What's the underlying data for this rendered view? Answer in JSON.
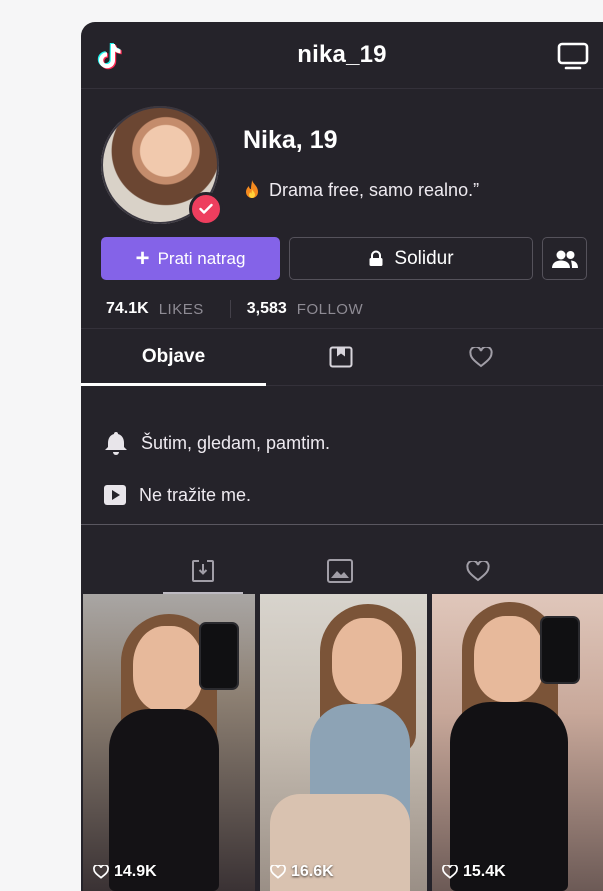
{
  "header": {
    "title": "nika_19",
    "left_icon": "tiktok-logo-icon",
    "right_icon": "tv-icon"
  },
  "profile": {
    "name": "Nika, 19",
    "bio": "Drama free, samo realno.”",
    "bio_icon": "fire-icon",
    "verified_icon": "checkmark-icon"
  },
  "actions": {
    "follow_label": "Prati natrag",
    "message_label": "Solidur",
    "friends_icon": "friends-icon"
  },
  "stats": [
    {
      "value": "74.1K",
      "label": "LIKES"
    },
    {
      "value": "3,583",
      "label": "FOLLOW"
    }
  ],
  "tabs": {
    "primary": [
      {
        "label": "Objave",
        "active": true
      },
      {
        "icon": "bookmark-icon"
      },
      {
        "icon": "heart-icon"
      }
    ],
    "secondary": [
      {
        "icon": "download-icon",
        "active": true
      },
      {
        "icon": "image-icon"
      },
      {
        "icon": "heart-icon"
      }
    ]
  },
  "info": [
    {
      "icon": "bell-icon",
      "text": "Šutim, gledam, pamtim."
    },
    {
      "icon": "video-play-icon",
      "text": "Ne tražite me."
    }
  ],
  "posts": [
    {
      "likes": "14.9K"
    },
    {
      "likes": "16.6K"
    },
    {
      "likes": "15.4K"
    }
  ],
  "colors": {
    "background": "#25232a",
    "accent": "#8463e8",
    "verified": "#ee3e5e"
  }
}
